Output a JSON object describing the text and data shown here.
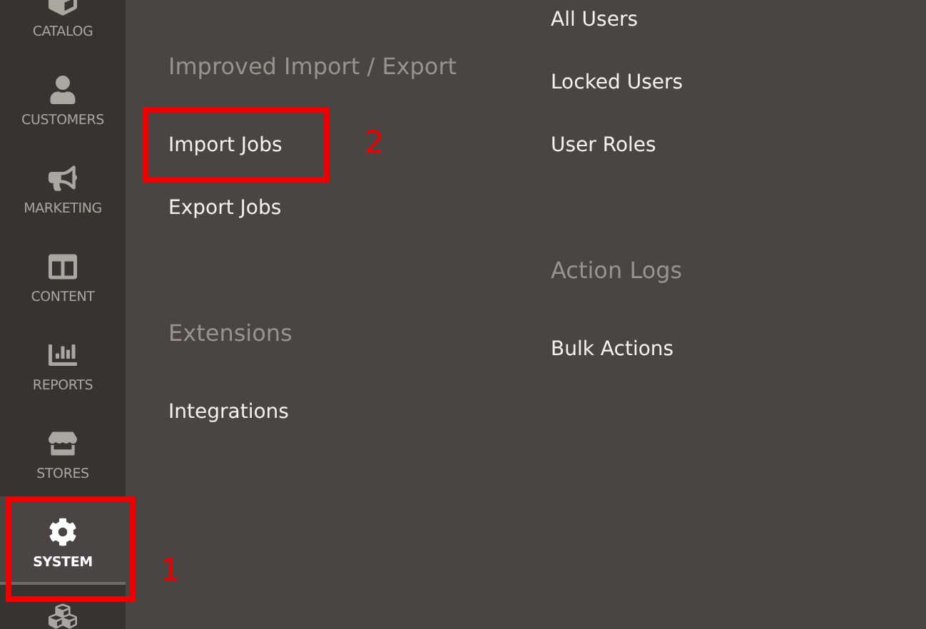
{
  "sidebar": {
    "items": [
      {
        "label": "CATALOG",
        "selected": false
      },
      {
        "label": "CUSTOMERS",
        "selected": false
      },
      {
        "label": "MARKETING",
        "selected": false
      },
      {
        "label": "CONTENT",
        "selected": false
      },
      {
        "label": "REPORTS",
        "selected": false
      },
      {
        "label": "STORES",
        "selected": false
      },
      {
        "label": "SYSTEM",
        "selected": true,
        "annotation": "1"
      },
      {
        "selected": false
      }
    ]
  },
  "menu": {
    "columns": [
      {
        "sections": [
          {
            "heading": "Improved Import / Export",
            "items": [
              {
                "label": "Import Jobs",
                "annotation": "2"
              },
              {
                "label": "Export Jobs"
              }
            ]
          },
          {
            "heading": "Extensions",
            "items": [
              {
                "label": "Integrations"
              }
            ]
          }
        ]
      },
      {
        "sections": [
          {
            "items": [
              {
                "label": "All Users"
              },
              {
                "label": "Locked Users"
              },
              {
                "label": "User Roles"
              }
            ]
          },
          {
            "heading": "Action Logs",
            "items": [
              {
                "label": "Bulk Actions"
              }
            ]
          }
        ]
      }
    ]
  }
}
